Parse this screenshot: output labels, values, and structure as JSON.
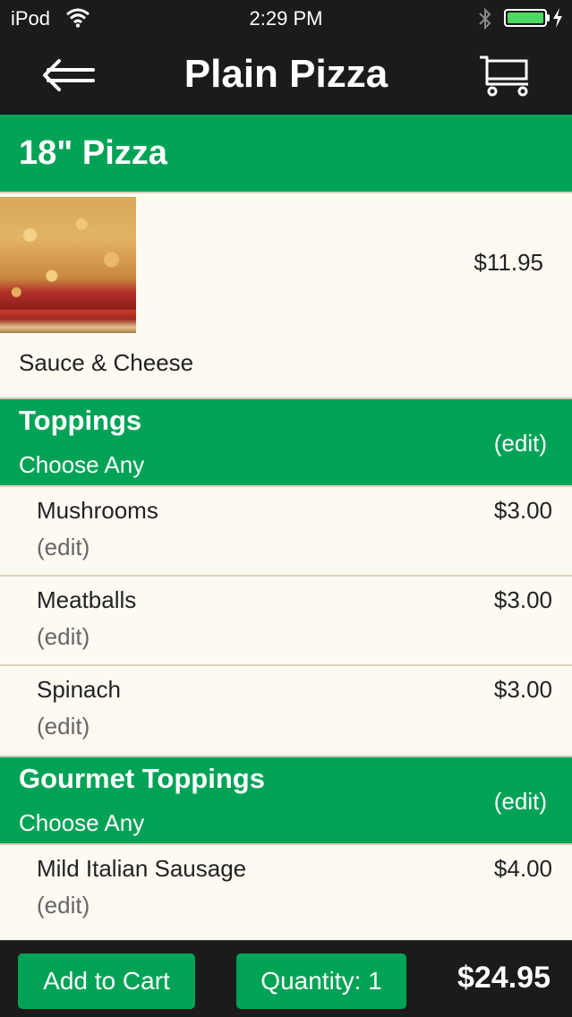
{
  "status_bar": {
    "carrier": "iPod",
    "time": "2:29 PM"
  },
  "nav": {
    "title": "Plain Pizza",
    "back_icon": "back-arrow-icon",
    "cart_icon": "cart-icon"
  },
  "item": {
    "title": "18\" Pizza",
    "price": "$11.95",
    "description": "Sauce & Cheese"
  },
  "groups": [
    {
      "title": "Toppings",
      "subtitle": "Choose Any",
      "edit": "(edit)",
      "options": [
        {
          "name": "Mushrooms",
          "price": "$3.00",
          "edit": "(edit)"
        },
        {
          "name": "Meatballs",
          "price": "$3.00",
          "edit": "(edit)"
        },
        {
          "name": "Spinach",
          "price": "$3.00",
          "edit": "(edit)"
        }
      ]
    },
    {
      "title": "Gourmet Toppings",
      "subtitle": "Choose Any",
      "edit": "(edit)",
      "options": [
        {
          "name": "Mild Italian Sausage",
          "price": "$4.00",
          "edit": "(edit)"
        }
      ]
    }
  ],
  "footer": {
    "add_to_cart": "Add to Cart",
    "quantity": "Quantity: 1",
    "total": "$24.95"
  },
  "colors": {
    "accent": "#00a356",
    "bar": "#1b1b1b",
    "background": "#fdfaf2",
    "battery": "#4cd964"
  }
}
